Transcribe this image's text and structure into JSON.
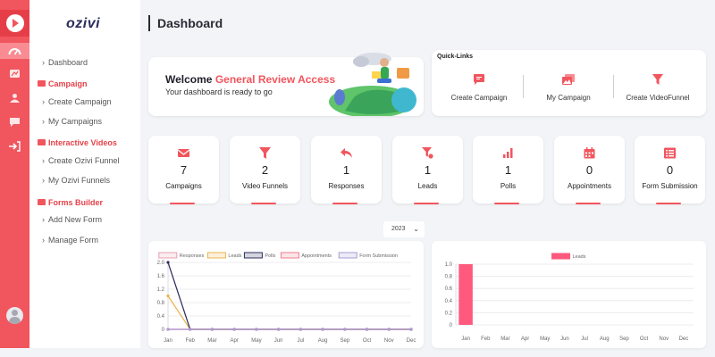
{
  "app": {
    "brand": "ozivi",
    "page_title": "Dashboard"
  },
  "sidebar": {
    "dashboard": "Dashboard",
    "sections": [
      {
        "heading": "Campaign",
        "items": [
          "Create Campaign",
          "My Campaigns"
        ]
      },
      {
        "heading": "Interactive Videos",
        "items": [
          "Create Ozivi Funnel",
          "My Ozivi Funnels"
        ]
      },
      {
        "heading": "Forms Builder",
        "items": [
          "Add New Form",
          "Manage Form"
        ]
      }
    ]
  },
  "welcome": {
    "title_prefix": "Welcome",
    "title_accent": "General Review Access",
    "subtitle": "Your dashboard is ready to go"
  },
  "quick_links": {
    "title": "Quick-Links",
    "items": [
      {
        "label": "Create Campaign",
        "icon": "message-icon"
      },
      {
        "label": "My Campaign",
        "icon": "images-icon"
      },
      {
        "label": "Create VideoFunnel",
        "icon": "funnel-icon"
      }
    ]
  },
  "stats": [
    {
      "label": "Campaigns",
      "value": "7",
      "icon": "envelope-icon"
    },
    {
      "label": "Video Funnels",
      "value": "2",
      "icon": "funnel-icon"
    },
    {
      "label": "Responses",
      "value": "1",
      "icon": "reply-icon"
    },
    {
      "label": "Leads",
      "value": "1",
      "icon": "lead-funnel-icon"
    },
    {
      "label": "Polls",
      "value": "1",
      "icon": "signal-bars-icon"
    },
    {
      "label": "Appointments",
      "value": "0",
      "icon": "calendar-icon"
    },
    {
      "label": "Form Submission",
      "value": "0",
      "icon": "list-icon"
    }
  ],
  "year_filter": {
    "value": "2023"
  },
  "colors": {
    "accent": "#f1555e",
    "rail": "#f1555e",
    "leads_bar": "#ff5a7e"
  },
  "chart_data": [
    {
      "type": "line",
      "categories": [
        "Jan",
        "Feb",
        "Mar",
        "Apr",
        "May",
        "Jun",
        "Jul",
        "Aug",
        "Sep",
        "Oct",
        "Nov",
        "Dec"
      ],
      "ylim": [
        0,
        2.0
      ],
      "y_ticks": [
        "0",
        "0.4",
        "0.8",
        "1.2",
        "1.6",
        "2.0"
      ],
      "legend": "top",
      "series": [
        {
          "name": "Responses",
          "color": "#e8a0b4",
          "values": [
            0,
            0,
            0,
            0,
            0,
            0,
            0,
            0,
            0,
            0,
            0,
            0
          ]
        },
        {
          "name": "Leads",
          "color": "#e9b44c",
          "values": [
            1,
            0,
            0,
            0,
            0,
            0,
            0,
            0,
            0,
            0,
            0,
            0
          ]
        },
        {
          "name": "Polls",
          "color": "#2b2d5c",
          "values": [
            2,
            0,
            0,
            0,
            0,
            0,
            0,
            0,
            0,
            0,
            0,
            0
          ]
        },
        {
          "name": "Appointments",
          "color": "#f07e8c",
          "values": [
            0,
            0,
            0,
            0,
            0,
            0,
            0,
            0,
            0,
            0,
            0,
            0
          ]
        },
        {
          "name": "Form Submission",
          "color": "#a99bd6",
          "values": [
            0,
            0,
            0,
            0,
            0,
            0,
            0,
            0,
            0,
            0,
            0,
            0
          ]
        }
      ]
    },
    {
      "type": "bar",
      "categories": [
        "Jan",
        "Feb",
        "Mar",
        "Apr",
        "May",
        "Jun",
        "Jul",
        "Aug",
        "Sep",
        "Oct",
        "Nov",
        "Dec"
      ],
      "ylim": [
        0,
        1.0
      ],
      "y_ticks": [
        "0",
        "0.2",
        "0.4",
        "0.6",
        "0.8",
        "1.0"
      ],
      "legend": "top",
      "series": [
        {
          "name": "Leads",
          "color": "#ff5a7e",
          "values": [
            1,
            0,
            0,
            0,
            0,
            0,
            0,
            0,
            0,
            0,
            0,
            0
          ]
        }
      ]
    }
  ]
}
